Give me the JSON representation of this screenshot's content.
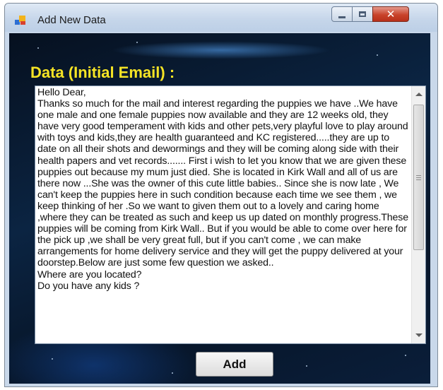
{
  "window": {
    "title": "Add New Data",
    "controls": {
      "minimize": "minimize",
      "maximize": "maximize",
      "close_glyph": "✕"
    }
  },
  "form": {
    "heading": "Data (Initial Email) :",
    "email_text": "Hello Dear,\nThanks so much for the mail and interest regarding the puppies we have ..We have one male and one female puppies now available and they are 12 weeks old, they have very good temperament with kids and other pets,very playful love to play around with toys and kids,they are health guaranteed and KC registered.....they are up to date on all their shots and dewormings and they will be coming along side with their health papers and vet records....... First i wish to let you know that we are given these puppies out because my mum just died. She is located in Kirk Wall and all of us are there now ...She was the owner of this cute little babies.. Since she is now late , We can't keep the puppies here in such condition because each time we see them , we keep thinking of her .So we want to given them out to a lovely and caring home ,where they can be treated as such and keep us up dated on monthly progress.These puppies will be coming from Kirk Wall.. But if you would be able to come over here for the pick up ,we shall be very great full, but if you can't come , we can make arrangements for home delivery service and they will get the puppy delivered at your doorstep.Below are just some few question we asked..\nWhere are you located?\nDo you have any kids ?",
    "add_label": "Add"
  },
  "colors": {
    "heading": "#f6e425",
    "background": "#0b2442",
    "close_button": "#c8432b"
  },
  "icons": {
    "app": "app-icon",
    "minimize": "minimize-icon",
    "maximize": "maximize-icon",
    "close": "close-icon"
  }
}
